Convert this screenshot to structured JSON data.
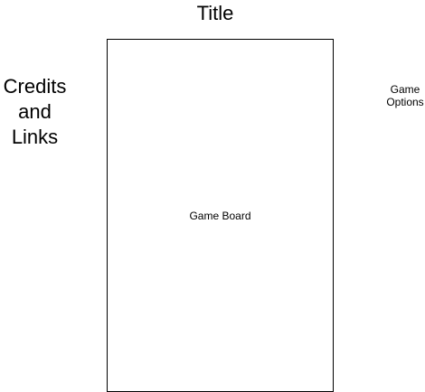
{
  "title": "Title",
  "credits": "Credits\nand\nLinks",
  "game_board": "Game Board",
  "game_options": "Game\nOptions",
  "colors": {
    "background": "#ffffff",
    "stroke": "#000000",
    "text": "#000000"
  }
}
